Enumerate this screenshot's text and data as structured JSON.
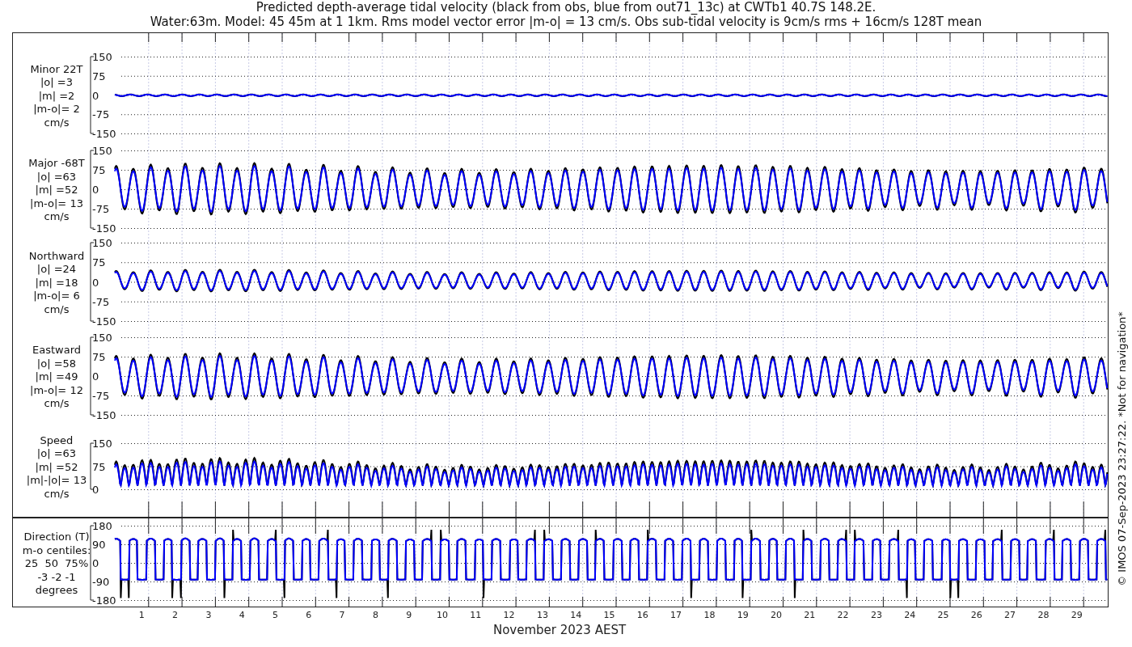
{
  "title_lines": [
    "Predicted depth-average tidal velocity (black from obs, blue from out71_13c) at CWTb1 40.7S 148.2E.",
    "Water:63m. Model: 45 45m at 1 1km. Rms model vector error |m-o| = 13 cm/s. Obs sub-tidal velocity is 9cm/s rms + 16cm/s 128T mean"
  ],
  "panels": [
    {
      "kind": "minor",
      "label_lines": [
        "Minor 22T",
        "|o| =3",
        "|m| =2",
        "|m-o|= 2",
        "cm/s"
      ],
      "yticks": [
        "150",
        "75",
        "0",
        "-75",
        "-150"
      ]
    },
    {
      "kind": "major",
      "label_lines": [
        "Major -68T",
        "|o| =63",
        "|m| =52",
        "|m-o|= 13",
        "cm/s"
      ],
      "yticks": [
        "150",
        "75",
        "0",
        "-75",
        "-150"
      ]
    },
    {
      "kind": "north",
      "label_lines": [
        "Northward",
        "|o| =24",
        "|m| =18",
        "|m-o|= 6",
        "cm/s"
      ],
      "yticks": [
        "150",
        "75",
        "0",
        "-75",
        "-150"
      ]
    },
    {
      "kind": "east",
      "label_lines": [
        "Eastward",
        "|o| =58",
        "|m| =49",
        "|m-o|= 12",
        "cm/s"
      ],
      "yticks": [
        "150",
        "75",
        "0",
        "-75",
        "-150"
      ]
    },
    {
      "kind": "speed",
      "label_lines": [
        "Speed",
        "|o| =63",
        "|m| =52",
        "|m|-|o|= 13",
        "cm/s"
      ],
      "yticks": [
        "150",
        "75",
        "0"
      ]
    },
    {
      "kind": "direction",
      "label_lines": [
        "Direction (T)",
        "m-o centiles:",
        "25  50  75%",
        "-3 -2 -1",
        "degrees"
      ],
      "yticks": [
        "180",
        "90",
        "0",
        "-90",
        "-180"
      ]
    }
  ],
  "days": [
    "1",
    "2",
    "3",
    "4",
    "5",
    "6",
    "7",
    "8",
    "9",
    "10",
    "11",
    "12",
    "13",
    "14",
    "15",
    "16",
    "17",
    "18",
    "19",
    "20",
    "21",
    "22",
    "23",
    "24",
    "25",
    "26",
    "27",
    "28",
    "29"
  ],
  "xlabel": "November 2023 AEST",
  "side_note": "© IMOS 07-Sep-2023 23:27:22. *Not for navigation*"
}
